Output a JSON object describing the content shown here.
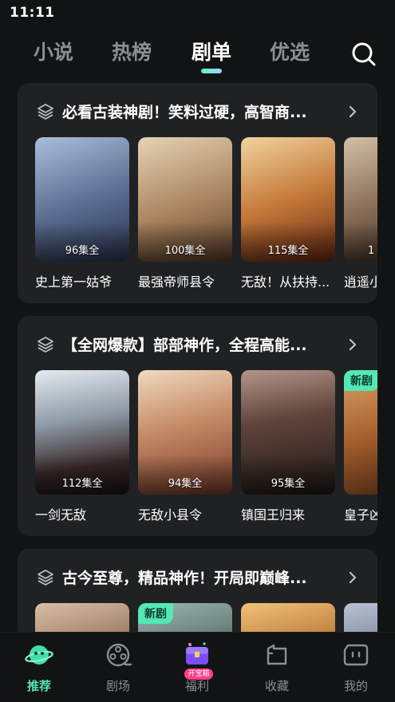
{
  "status_bar": {
    "time": "11:11"
  },
  "top_tabs": [
    {
      "label": "小说",
      "active": false
    },
    {
      "label": "热榜",
      "active": false
    },
    {
      "label": "剧单",
      "active": true
    },
    {
      "label": "优选",
      "active": false
    }
  ],
  "sections": [
    {
      "title": "必看古装神剧！笑料过硬，高智商...",
      "cards": [
        {
          "name": "史上第一姑爷",
          "episodes": "96集全",
          "new": false,
          "colors": [
            "#8fa6c4",
            "#3d4a66"
          ]
        },
        {
          "name": "最强帝师县令",
          "episodes": "100集全",
          "new": false,
          "colors": [
            "#c9b49a",
            "#6b5138"
          ]
        },
        {
          "name": "无敌！从扶持...",
          "episodes": "115集全",
          "new": false,
          "colors": [
            "#d8a35a",
            "#6a2a14"
          ]
        },
        {
          "name": "逍遥小",
          "episodes": "1",
          "new": false,
          "colors": [
            "#b7a48b",
            "#3c2b22"
          ]
        }
      ]
    },
    {
      "title": "【全网爆款】部部神作，全程高能...",
      "cards": [
        {
          "name": "一剑无敌",
          "episodes": "112集全",
          "new": false,
          "colors": [
            "#c9d3dc",
            "#2a2e36"
          ]
        },
        {
          "name": "无敌小县令",
          "episodes": "94集全",
          "new": false,
          "colors": [
            "#e0b99a",
            "#7a3b2a"
          ]
        },
        {
          "name": "镇国王归来",
          "episodes": "95集全",
          "new": false,
          "colors": [
            "#8a6a5a",
            "#1a1412"
          ]
        },
        {
          "name": "皇子凶",
          "episodes": "",
          "new": true,
          "new_label": "新剧",
          "colors": [
            "#c2783b",
            "#3a1d10"
          ]
        }
      ]
    },
    {
      "title": "古今至尊，精品神作！开局即巅峰...",
      "cards": [
        {
          "name": "",
          "episodes": "",
          "new": false,
          "colors": [
            "#b99a80",
            "#4a3326"
          ]
        },
        {
          "name": "",
          "episodes": "",
          "new": true,
          "new_label": "新剧",
          "colors": [
            "#6f8a86",
            "#1d2a2a"
          ]
        },
        {
          "name": "",
          "episodes": "",
          "new": false,
          "colors": [
            "#d8a25c",
            "#4a2512"
          ]
        },
        {
          "name": "",
          "episodes": "",
          "new": false,
          "colors": [
            "#8b96a8",
            "#2a3040"
          ]
        }
      ]
    }
  ],
  "bottom_nav": [
    {
      "label": "推荐",
      "icon": "planet-icon",
      "active": true
    },
    {
      "label": "剧场",
      "icon": "film-reel-icon",
      "active": false
    },
    {
      "label": "福利",
      "icon": "treasure-chest-icon",
      "active": false,
      "tag": "开宝箱"
    },
    {
      "label": "收藏",
      "icon": "folder-icon",
      "active": false
    },
    {
      "label": "我的",
      "icon": "profile-face-icon",
      "active": false
    }
  ],
  "colors": {
    "accent": "#52e3b6",
    "background": "#121314",
    "card_bg": "#202123",
    "inactive": "#8c8e91"
  }
}
